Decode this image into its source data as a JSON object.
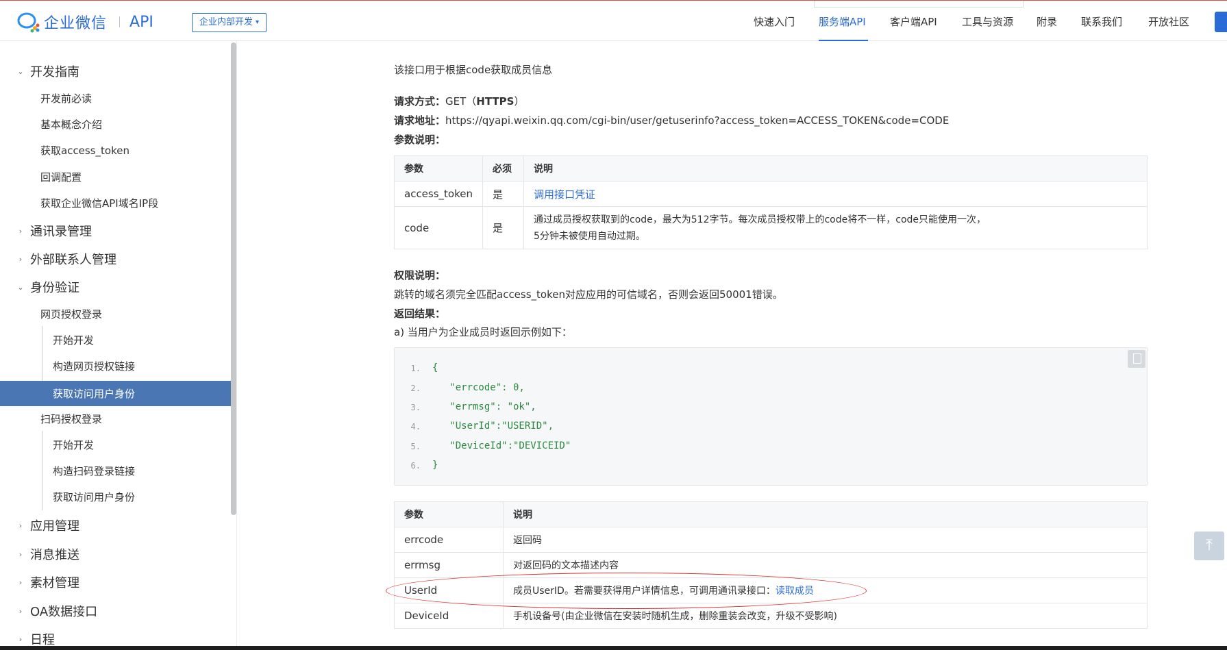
{
  "header": {
    "brand": "企业微信",
    "api": "API",
    "scope": "企业内部开发",
    "nav": [
      "快速入门",
      "服务端API",
      "客户端API",
      "工具与资源",
      "附录",
      "联系我们",
      "开放社区"
    ],
    "active_nav": "服务端API"
  },
  "sidebar": {
    "guide": "开发指南",
    "guide_items": [
      "开发前必读",
      "基本概念介绍",
      "获取access_token",
      "回调配置",
      "获取企业微信API域名IP段"
    ],
    "contacts": "通讯录管理",
    "external": "外部联系人管理",
    "auth": "身份验证",
    "web_auth": "网页授权登录",
    "web_auth_children": [
      "开始开发",
      "构造网页授权链接",
      "获取访问用户身份"
    ],
    "scan_auth": "扫码授权登录",
    "scan_auth_children": [
      "开始开发",
      "构造扫码登录链接",
      "获取访问用户身份"
    ],
    "more": [
      "应用管理",
      "消息推送",
      "素材管理",
      "OA数据接口",
      "日程"
    ]
  },
  "content": {
    "intro": "该接口用于根据code获取成员信息",
    "method_label": "请求方式：",
    "method_value": "GET（",
    "method_https": "HTTPS",
    "method_close": "）",
    "url_label": "请求地址：",
    "url_value": "https://qyapi.weixin.qq.com/cgi-bin/user/getuserinfo?access_token=ACCESS_TOKEN&code=CODE",
    "params_label": "参数说明：",
    "params_table": {
      "headers": [
        "参数",
        "必须",
        "说明"
      ],
      "rows": [
        [
          "access_token",
          "是",
          "调用接口凭证"
        ],
        [
          "code",
          "是",
          "通过成员授权获取到的code，最大为512字节。每次成员授权带上的code将不一样，code只能使用一次，",
          "5分钟未被使用自动过期。"
        ]
      ]
    },
    "perm_label": "权限说明：",
    "perm_text": "跳转的域名须完全匹配access_token对应应用的可信域名，否则会返回50001错误。",
    "result_label": "返回结果：",
    "result_a": "a) 当用户为企业成员时返回示例如下：",
    "code_lines": [
      "{",
      "   \"errcode\": 0,",
      "   \"errmsg\": \"ok\",",
      "   \"UserId\":\"USERID\",",
      "   \"DeviceId\":\"DEVICEID\"",
      "}"
    ],
    "line_numbers": [
      "1.",
      "2.",
      "3.",
      "4.",
      "5.",
      "6."
    ],
    "result_table": {
      "headers": [
        "参数",
        "说明"
      ],
      "rows": [
        [
          "errcode",
          "返回码"
        ],
        [
          "errmsg",
          "对返回码的文本描述内容"
        ],
        [
          "UserId",
          "成员UserID。若需要获得用户详情信息，可调用通讯录接口：",
          "读取成员"
        ],
        [
          "DeviceId",
          "手机设备号(由企业微信在安装时随机生成，删除重装会改变，升级不受影响)"
        ]
      ]
    }
  }
}
